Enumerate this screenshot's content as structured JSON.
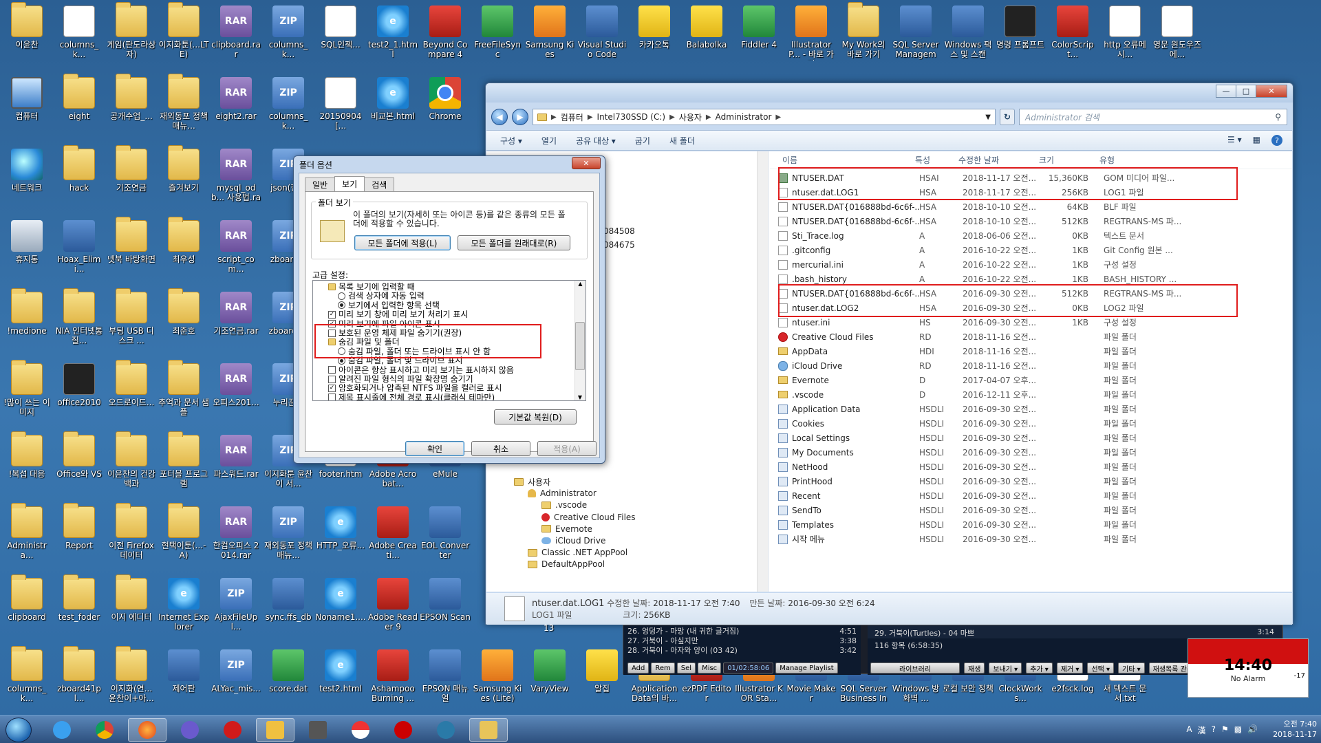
{
  "desktop": {
    "icons": [
      {
        "label": "이윤찬",
        "kind": "folder"
      },
      {
        "label": "columns_k...",
        "kind": "doc"
      },
      {
        "label": "게임(판도라상자)",
        "kind": "folder"
      },
      {
        "label": "이지화툰(...LTE)",
        "kind": "folder"
      },
      {
        "label": "clipboard.rar",
        "kind": "rar"
      },
      {
        "label": "columns_k...",
        "kind": "zip"
      },
      {
        "label": "SQL인젝...",
        "kind": "doc"
      },
      {
        "label": "test2_1.html",
        "kind": "ie"
      },
      {
        "label": "Beyond Compare 4",
        "kind": "red"
      },
      {
        "label": "FreeFileSync",
        "kind": "green"
      },
      {
        "label": "Samsung Kies",
        "kind": "orange"
      },
      {
        "label": "Visual Studio Code",
        "kind": "app"
      },
      {
        "label": "카카오톡",
        "kind": "yellow"
      },
      {
        "label": "Balabolka",
        "kind": "yellow"
      },
      {
        "label": "Fiddler 4",
        "kind": "green"
      },
      {
        "label": "IllustratorP... - 바로 가기",
        "kind": "orange"
      },
      {
        "label": "My Work의 바로 가기",
        "kind": "folder"
      },
      {
        "label": "SQL Server Manageme...",
        "kind": "app"
      },
      {
        "label": "Windows 팩스 및 스캔",
        "kind": "app"
      },
      {
        "label": "명령 프롬프트",
        "kind": "dark"
      },
      {
        "label": "ColorScript...",
        "kind": "red"
      },
      {
        "label": "http 오류메시...",
        "kind": "doc"
      },
      {
        "label": "영문 윈도우즈에...",
        "kind": "doc"
      },
      {
        "label": "컴퓨터",
        "kind": "monitor"
      },
      {
        "label": "eight",
        "kind": "folder"
      },
      {
        "label": "공개수업_...",
        "kind": "folder"
      },
      {
        "label": "재외동포 정책 매뉴...",
        "kind": "folder"
      },
      {
        "label": "eight2.rar",
        "kind": "rar"
      },
      {
        "label": "columns_k...",
        "kind": "zip"
      },
      {
        "label": "20150904[...",
        "kind": "doc"
      },
      {
        "label": "비교본.html",
        "kind": "ie"
      },
      {
        "label": "Chrome",
        "kind": "chrome"
      },
      {
        "label": "네트워크",
        "kind": "globe"
      },
      {
        "label": "hack",
        "kind": "folder"
      },
      {
        "label": "기조연금",
        "kind": "folder"
      },
      {
        "label": "즐겨보기",
        "kind": "folder"
      },
      {
        "label": "mysql_odb... 사용법.rar",
        "kind": "rar"
      },
      {
        "label": "json(한...",
        "kind": "zip"
      },
      {
        "label": "휴지통",
        "kind": "bin"
      },
      {
        "label": "Hoax_Elimi...",
        "kind": "app"
      },
      {
        "label": "넷북 바탕화면",
        "kind": "folder"
      },
      {
        "label": "최우성",
        "kind": "folder"
      },
      {
        "label": "script_com...",
        "kind": "rar"
      },
      {
        "label": "zboard...",
        "kind": "zip"
      },
      {
        "label": "!medione",
        "kind": "folder"
      },
      {
        "label": "NIA 인터넷통질...",
        "kind": "folder"
      },
      {
        "label": "부팅 USB 디스크 ...",
        "kind": "folder"
      },
      {
        "label": "최준호",
        "kind": "folder"
      },
      {
        "label": "기조연금.rar",
        "kind": "rar"
      },
      {
        "label": "zboard-...",
        "kind": "zip"
      },
      {
        "label": "!많이 쓰는 이미지",
        "kind": "folder"
      },
      {
        "label": "office2010",
        "kind": "dark"
      },
      {
        "label": "오드로이드...",
        "kind": "folder"
      },
      {
        "label": "추억과 문서 샘플",
        "kind": "folder"
      },
      {
        "label": "오피스201...",
        "kind": "rar"
      },
      {
        "label": "누리꾼...",
        "kind": "zip"
      },
      {
        "label": "!복섭 대응",
        "kind": "folder"
      },
      {
        "label": "Office와 VS",
        "kind": "folder"
      },
      {
        "label": "이윤찬의 건강백과",
        "kind": "folder"
      },
      {
        "label": "포터블 프로그램",
        "kind": "folder"
      },
      {
        "label": "파스워드.rar",
        "kind": "rar"
      },
      {
        "label": "이지화툰 윤찬이 서...",
        "kind": "zip"
      },
      {
        "label": "footer.htm",
        "kind": "doc"
      },
      {
        "label": "Adobe Acrobat...",
        "kind": "red"
      },
      {
        "label": "eMule",
        "kind": "app"
      },
      {
        "label": "Administra...",
        "kind": "folder"
      },
      {
        "label": "Report",
        "kind": "folder"
      },
      {
        "label": "이전 Firefox 데이터",
        "kind": "folder"
      },
      {
        "label": "현택이툰(...-A)",
        "kind": "folder"
      },
      {
        "label": "한컴오피스 2014.rar",
        "kind": "rar"
      },
      {
        "label": "재외동포 정책 매뉴...",
        "kind": "zip"
      },
      {
        "label": "HTTP_오류...",
        "kind": "ie"
      },
      {
        "label": "Adobe Creati...",
        "kind": "red"
      },
      {
        "label": "EOL Converter",
        "kind": "app"
      },
      {
        "label": "clipboard",
        "kind": "folder"
      },
      {
        "label": "test_foder",
        "kind": "folder"
      },
      {
        "label": "이지 에디터",
        "kind": "folder"
      },
      {
        "label": "Internet Explorer",
        "kind": "ie"
      },
      {
        "label": "AjaxFileUpl...",
        "kind": "zip"
      },
      {
        "label": "sync.ffs_db",
        "kind": "app"
      },
      {
        "label": "Noname1....",
        "kind": "ie"
      },
      {
        "label": "Adobe Reader 9",
        "kind": "red"
      },
      {
        "label": "EPSON Scan",
        "kind": "app"
      },
      {
        "label": "columns_k...",
        "kind": "folder"
      },
      {
        "label": "zboard41pl...",
        "kind": "folder"
      },
      {
        "label": "이지화(연... 윤찬이+아...",
        "kind": "folder"
      },
      {
        "label": "제어판",
        "kind": "app"
      },
      {
        "label": "ALYac_mis...",
        "kind": "zip"
      },
      {
        "label": "score.dat",
        "kind": "green"
      },
      {
        "label": "test2.html",
        "kind": "ie"
      },
      {
        "label": "Ashampoo Burning ...",
        "kind": "red"
      },
      {
        "label": "EPSON 매뉴얼",
        "kind": "app"
      },
      {
        "label": "Samsung Kies (Lite)",
        "kind": "orange"
      },
      {
        "label": "VaryView",
        "kind": "green"
      },
      {
        "label": "알집",
        "kind": "yellow"
      },
      {
        "label": "Application Data의 바...",
        "kind": "folder"
      },
      {
        "label": "ezPDF Editor",
        "kind": "red"
      },
      {
        "label": "Illustrator KOR Sta...",
        "kind": "orange"
      },
      {
        "label": "Movie Maker",
        "kind": "app"
      },
      {
        "label": "SQL Server Business Int...",
        "kind": "app"
      },
      {
        "label": "Windows 방화벽 ...",
        "kind": "app"
      },
      {
        "label": "로컬 보안 정책",
        "kind": "app"
      },
      {
        "label": "ClockWorks...",
        "kind": "app"
      },
      {
        "label": "e2fsck.log",
        "kind": "doc"
      },
      {
        "label": "새 텍스트 문서.txt",
        "kind": "doc"
      }
    ]
  },
  "explorer": {
    "address": [
      "컴퓨터",
      "Intel730SSD (C:)",
      "사용자",
      "Administrator"
    ],
    "search_placeholder": "Administrator 검색",
    "toolbar": [
      "구성 ▾",
      "열기",
      "공유 대상 ▾",
      "굽기",
      "새 폴더"
    ],
    "columns": [
      "이름",
      "특성",
      "수정한 날짜",
      "크기",
      "유형"
    ],
    "files": [
      {
        "name": "NTUSER.DAT",
        "attr": "HSAI",
        "date": "2018-11-17 오전...",
        "size": "15,360KB",
        "type": "GOM 미디어 파일...",
        "icon": "gom"
      },
      {
        "name": "ntuser.dat.LOG1",
        "attr": "HSA",
        "date": "2018-11-17 오전...",
        "size": "256KB",
        "type": "LOG1 파일",
        "icon": "file"
      },
      {
        "name": "NTUSER.DAT{016888bd-6c6f-...",
        "attr": "HSA",
        "date": "2018-10-10 오전...",
        "size": "64KB",
        "type": "BLF 파일",
        "icon": "file"
      },
      {
        "name": "NTUSER.DAT{016888bd-6c6f-...",
        "attr": "HSA",
        "date": "2018-10-10 오전...",
        "size": "512KB",
        "type": "REGTRANS-MS 파...",
        "icon": "file"
      },
      {
        "name": "Sti_Trace.log",
        "attr": "A",
        "date": "2018-06-06 오전...",
        "size": "0KB",
        "type": "텍스트 문서",
        "icon": "file"
      },
      {
        "name": ".gitconfig",
        "attr": "A",
        "date": "2016-10-22 오전...",
        "size": "1KB",
        "type": "Git Config 원본 ...",
        "icon": "file"
      },
      {
        "name": "mercurial.ini",
        "attr": "A",
        "date": "2016-10-22 오전...",
        "size": "1KB",
        "type": "구성 설정",
        "icon": "file"
      },
      {
        "name": ".bash_history",
        "attr": "A",
        "date": "2016-10-22 오전...",
        "size": "1KB",
        "type": "BASH_HISTORY ...",
        "icon": "file"
      },
      {
        "name": "NTUSER.DAT{016888bd-6c6f-...",
        "attr": "HSA",
        "date": "2016-09-30 오전...",
        "size": "512KB",
        "type": "REGTRANS-MS 파...",
        "icon": "file"
      },
      {
        "name": "ntuser.dat.LOG2",
        "attr": "HSA",
        "date": "2016-09-30 오전...",
        "size": "0KB",
        "type": "LOG2 파일",
        "icon": "file"
      },
      {
        "name": "ntuser.ini",
        "attr": "HS",
        "date": "2016-09-30 오전...",
        "size": "1KB",
        "type": "구성 설정",
        "icon": "file"
      },
      {
        "name": "Creative Cloud Files",
        "attr": "RD",
        "date": "2018-11-16 오전...",
        "size": "",
        "type": "파일 폴더",
        "icon": "cc"
      },
      {
        "name": "AppData",
        "attr": "HDI",
        "date": "2018-11-16 오전...",
        "size": "",
        "type": "파일 폴더",
        "icon": "folder"
      },
      {
        "name": "iCloud Drive",
        "attr": "RD",
        "date": "2018-11-16 오전...",
        "size": "",
        "type": "파일 폴더",
        "icon": "icl"
      },
      {
        "name": "Evernote",
        "attr": "D",
        "date": "2017-04-07 오후...",
        "size": "",
        "type": "파일 폴더",
        "icon": "folder"
      },
      {
        "name": ".vscode",
        "attr": "D",
        "date": "2016-12-11 오후...",
        "size": "",
        "type": "파일 폴더",
        "icon": "folder"
      },
      {
        "name": "Application Data",
        "attr": "HSDLI",
        "date": "2016-09-30 오전...",
        "size": "",
        "type": "파일 폴더",
        "icon": "link"
      },
      {
        "name": "Cookies",
        "attr": "HSDLI",
        "date": "2016-09-30 오전...",
        "size": "",
        "type": "파일 폴더",
        "icon": "link"
      },
      {
        "name": "Local Settings",
        "attr": "HSDLI",
        "date": "2016-09-30 오전...",
        "size": "",
        "type": "파일 폴더",
        "icon": "link"
      },
      {
        "name": "My Documents",
        "attr": "HSDLI",
        "date": "2016-09-30 오전...",
        "size": "",
        "type": "파일 폴더",
        "icon": "link"
      },
      {
        "name": "NetHood",
        "attr": "HSDLI",
        "date": "2016-09-30 오전...",
        "size": "",
        "type": "파일 폴더",
        "icon": "link"
      },
      {
        "name": "PrintHood",
        "attr": "HSDLI",
        "date": "2016-09-30 오전...",
        "size": "",
        "type": "파일 폴더",
        "icon": "link"
      },
      {
        "name": "Recent",
        "attr": "HSDLI",
        "date": "2016-09-30 오전...",
        "size": "",
        "type": "파일 폴더",
        "icon": "link"
      },
      {
        "name": "SendTo",
        "attr": "HSDLI",
        "date": "2016-09-30 오전...",
        "size": "",
        "type": "파일 폴더",
        "icon": "link"
      },
      {
        "name": "Templates",
        "attr": "HSDLI",
        "date": "2016-09-30 오전...",
        "size": "",
        "type": "파일 폴더",
        "icon": "link"
      },
      {
        "name": "시작 메뉴",
        "attr": "HSDLI",
        "date": "2016-09-30 오전...",
        "size": "",
        "type": "파일 폴더",
        "icon": "link"
      }
    ],
    "nav_partial": [
      "084508",
      "084675"
    ],
    "nav_tree": [
      {
        "label": "사용자",
        "icon": "folder",
        "indent": 0
      },
      {
        "label": "Administrator",
        "icon": "user",
        "indent": 1
      },
      {
        "label": ".vscode",
        "icon": "folder",
        "indent": 2
      },
      {
        "label": "Creative Cloud Files",
        "icon": "cc",
        "indent": 2
      },
      {
        "label": "Evernote",
        "icon": "folder",
        "indent": 2
      },
      {
        "label": "iCloud Drive",
        "icon": "icl",
        "indent": 2
      },
      {
        "label": "Classic .NET AppPool",
        "icon": "folder",
        "indent": 1
      },
      {
        "label": "DefaultAppPool",
        "icon": "folder",
        "indent": 1
      }
    ],
    "status": {
      "name": "ntuser.dat.LOG1",
      "modified_label": "수정한 날짜:",
      "modified": "2018-11-17 오전 7:40",
      "created_label": "만든 날짜:",
      "created": "2016-09-30 오전 6:24",
      "type": "LOG1 파일",
      "size_label": "크기:",
      "size": "256KB"
    }
  },
  "dialog": {
    "title": "폴더 옵션",
    "tabs": [
      "일반",
      "보기",
      "검색"
    ],
    "active_tab": "보기",
    "group_label": "폴더 보기",
    "group_text": "이 폴더의 보기(자세히 또는 아이콘 등)를 같은 종류의 모든 폴더에 적용할 수 있습니다.",
    "apply_all": "모든 폴더에 적용(L)",
    "reset_all": "모든 폴더를 원래대로(R)",
    "advanced_label": "고급 설정:",
    "advanced": [
      {
        "text": "목록 보기에 입력할 때",
        "kind": "folder",
        "level": 0
      },
      {
        "text": "검색 상자에 자동 입력",
        "kind": "radio",
        "checked": false,
        "level": 1
      },
      {
        "text": "보기에서 입력한 항목 선택",
        "kind": "radio",
        "checked": true,
        "level": 1
      },
      {
        "text": "미리 보기 창에 미리 보기 처리기 표시",
        "kind": "check",
        "checked": true,
        "level": 0
      },
      {
        "text": "미리 보기에 파일 아이콘 표시",
        "kind": "check",
        "checked": true,
        "level": 0
      },
      {
        "text": "보호된 운영 체제 파일 숨기기(권장)",
        "kind": "check",
        "checked": false,
        "level": 0
      },
      {
        "text": "숨김 파일 및 폴더",
        "kind": "folder",
        "level": 0
      },
      {
        "text": "숨김 파일, 폴더 또는 드라이브 표시 안 함",
        "kind": "radio",
        "checked": false,
        "level": 1
      },
      {
        "text": "숨김 파일, 폴더 및 드라이브 표시",
        "kind": "radio",
        "checked": true,
        "level": 1
      },
      {
        "text": "아이콘은 항상 표시하고 미리 보기는 표시하지 않음",
        "kind": "check",
        "checked": false,
        "level": 0
      },
      {
        "text": "알려진 파일 형식의 파일 확장명 숨기기",
        "kind": "check",
        "checked": false,
        "level": 0
      },
      {
        "text": "암호화되거나 압축된 NTFS 파일을 컬러로 표시",
        "kind": "check",
        "checked": true,
        "level": 0
      },
      {
        "text": "제목 표시줄에 전체 경로 표시(클래식 테마만)",
        "kind": "check",
        "checked": false,
        "level": 0
      }
    ],
    "restore_defaults": "기본값 복원(D)",
    "ok": "확인",
    "cancel": "취소",
    "apply": "적용(A)"
  },
  "player": {
    "left_lines": [
      {
        "text": "26. 엉덩가 - 마망 (내 귀한 글거짐)",
        "time": "4:51"
      },
      {
        "text": "27. 거북이 - 아싶지만",
        "time": "3:38"
      },
      {
        "text": "28. 거북이 - 아자와 양이 (03 42)",
        "time": "3:42"
      }
    ],
    "left_buttons": [
      "Add",
      "Rem",
      "Sel",
      "Misc",
      "01/02:58:06",
      "Manage Playlist"
    ],
    "now": "29. 거북이(Turtles) - 04 마쁘",
    "now_time": "3:14",
    "count": "116 항목 (6:58:35)",
    "library": "라이브러리",
    "right_buttons": [
      "재생",
      "보내기 ▾",
      "추가 ▾",
      "제거 ▾",
      "선택 ▾",
      "기타 ▾",
      "재생목록 관리 ▾"
    ],
    "partial_number": "13"
  },
  "clock_widget": {
    "time": "14:40",
    "alarm": "No Alarm",
    "badge": "-17"
  },
  "taskbar": {
    "time": "오전 7:40",
    "date": "2018-11-17",
    "apps": [
      "ie",
      "chrome",
      "firefox",
      "s",
      "opera",
      "chart",
      "box",
      "pokeball",
      "record",
      "snow",
      "explorer"
    ],
    "tray": [
      "A",
      "漢",
      "?"
    ]
  }
}
